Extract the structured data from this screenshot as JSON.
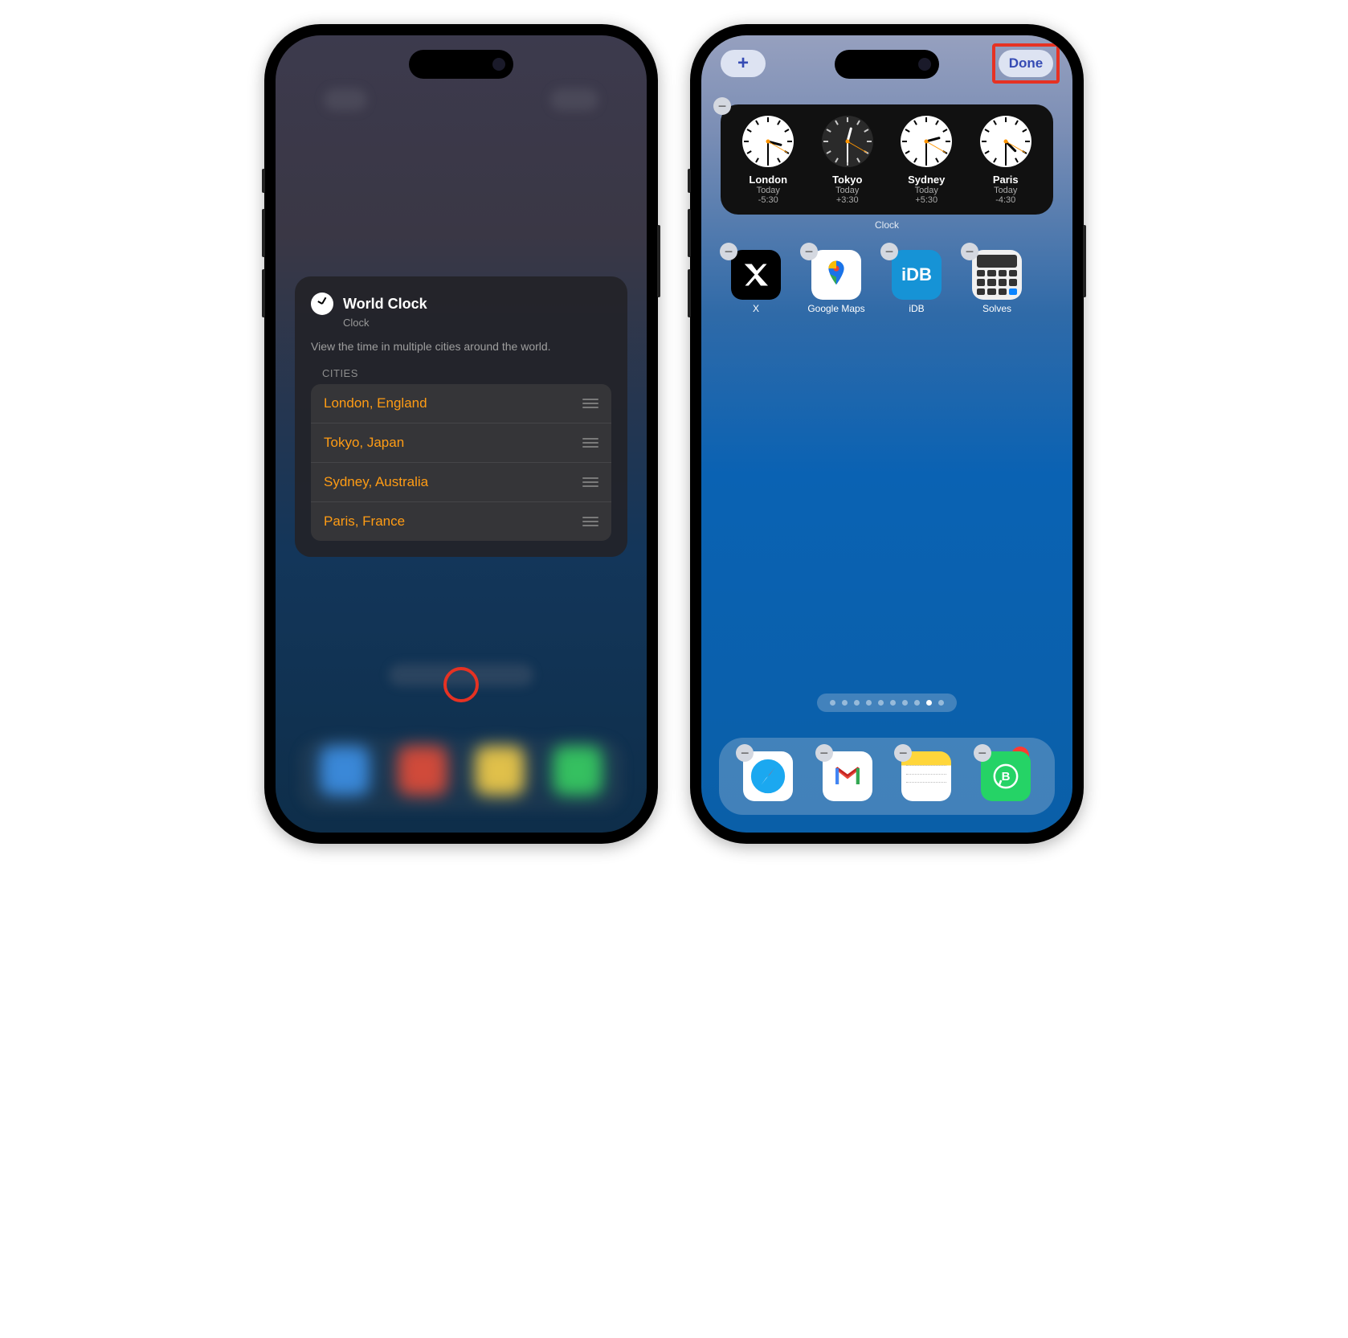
{
  "left": {
    "sheet_title": "World Clock",
    "sheet_sub": "Clock",
    "sheet_desc": "View the time in multiple cities around the world.",
    "cities_header": "CITIES",
    "cities": [
      "London, England",
      "Tokyo, Japan",
      "Sydney, Australia",
      "Paris, France"
    ]
  },
  "right": {
    "add_label": "+",
    "done_label": "Done",
    "widget_label": "Clock",
    "clocks": [
      {
        "city": "London",
        "day": "Today",
        "offset": "-5:30",
        "dark": false,
        "hour_deg": 105,
        "min_deg": 180,
        "sec_deg": 120
      },
      {
        "city": "Tokyo",
        "day": "Today",
        "offset": "+3:30",
        "dark": true,
        "hour_deg": 375,
        "min_deg": 180,
        "sec_deg": 120
      },
      {
        "city": "Sydney",
        "day": "Today",
        "offset": "+5:30",
        "dark": false,
        "hour_deg": 435,
        "min_deg": 180,
        "sec_deg": 120
      },
      {
        "city": "Paris",
        "day": "Today",
        "offset": "-4:30",
        "dark": false,
        "hour_deg": 135,
        "min_deg": 180,
        "sec_deg": 120
      }
    ],
    "apps": [
      {
        "name": "X"
      },
      {
        "name": "Google Maps"
      },
      {
        "name": "iDB"
      },
      {
        "name": "Solves"
      }
    ],
    "dock": [
      {
        "name": "Safari"
      },
      {
        "name": "Gmail"
      },
      {
        "name": "Notes"
      },
      {
        "name": "WhatsApp Business",
        "badge": "1"
      }
    ],
    "page_count": 10,
    "active_page": 8
  }
}
